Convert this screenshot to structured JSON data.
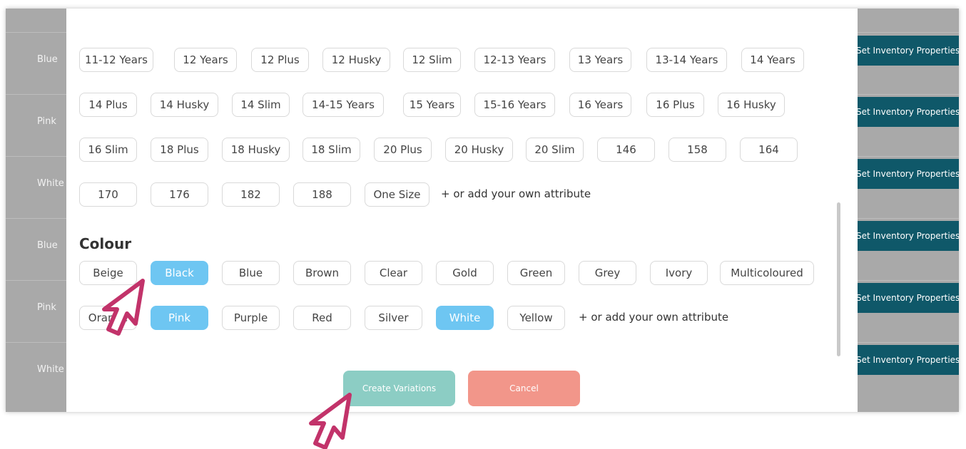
{
  "background": {
    "rows": [
      {
        "label": "Blue"
      },
      {
        "label": "Pink"
      },
      {
        "label": "White"
      },
      {
        "label": "Blue"
      },
      {
        "label": "Pink"
      },
      {
        "label": "White"
      }
    ],
    "inventory_button_label": "Set Inventory Properties"
  },
  "size_chips": [
    [
      "11-12 Years",
      "12 Years",
      "12 Plus",
      "12 Husky",
      "12 Slim",
      "12-13 Years",
      "13 Years",
      "13-14 Years",
      "14 Years"
    ],
    [
      "14 Plus",
      "14 Husky",
      "14 Slim",
      "14-15 Years",
      "15 Years",
      "15-16 Years",
      "16 Years",
      "16 Plus",
      "16 Husky"
    ],
    [
      "16 Slim",
      "18 Plus",
      "18 Husky",
      "18 Slim",
      "20 Plus",
      "20 Husky",
      "20 Slim",
      "146",
      "158",
      "164"
    ],
    [
      "170",
      "176",
      "182",
      "188",
      "One Size"
    ]
  ],
  "add_own_attribute": "+ or add your own attribute",
  "colour": {
    "title": "Colour",
    "rows": [
      [
        {
          "label": "Beige",
          "selected": false
        },
        {
          "label": "Black",
          "selected": true
        },
        {
          "label": "Blue",
          "selected": false
        },
        {
          "label": "Brown",
          "selected": false
        },
        {
          "label": "Clear",
          "selected": false
        },
        {
          "label": "Gold",
          "selected": false
        },
        {
          "label": "Green",
          "selected": false
        },
        {
          "label": "Grey",
          "selected": false
        },
        {
          "label": "Ivory",
          "selected": false
        },
        {
          "label": "Multicoloured",
          "selected": false
        }
      ],
      [
        {
          "label": "Orange",
          "selected": false
        },
        {
          "label": "Pink",
          "selected": true
        },
        {
          "label": "Purple",
          "selected": false
        },
        {
          "label": "Red",
          "selected": false
        },
        {
          "label": "Silver",
          "selected": false
        },
        {
          "label": "White",
          "selected": true
        },
        {
          "label": "Yellow",
          "selected": false
        }
      ]
    ]
  },
  "actions": {
    "create_label": "Create Variations",
    "cancel_label": "Cancel"
  },
  "colors": {
    "selected_chip": "#6ec6f2",
    "create_button": "#8ccdc4",
    "cancel_button": "#f2968a",
    "inventory_button": "#0f5869",
    "pointer": "#c2336a"
  }
}
